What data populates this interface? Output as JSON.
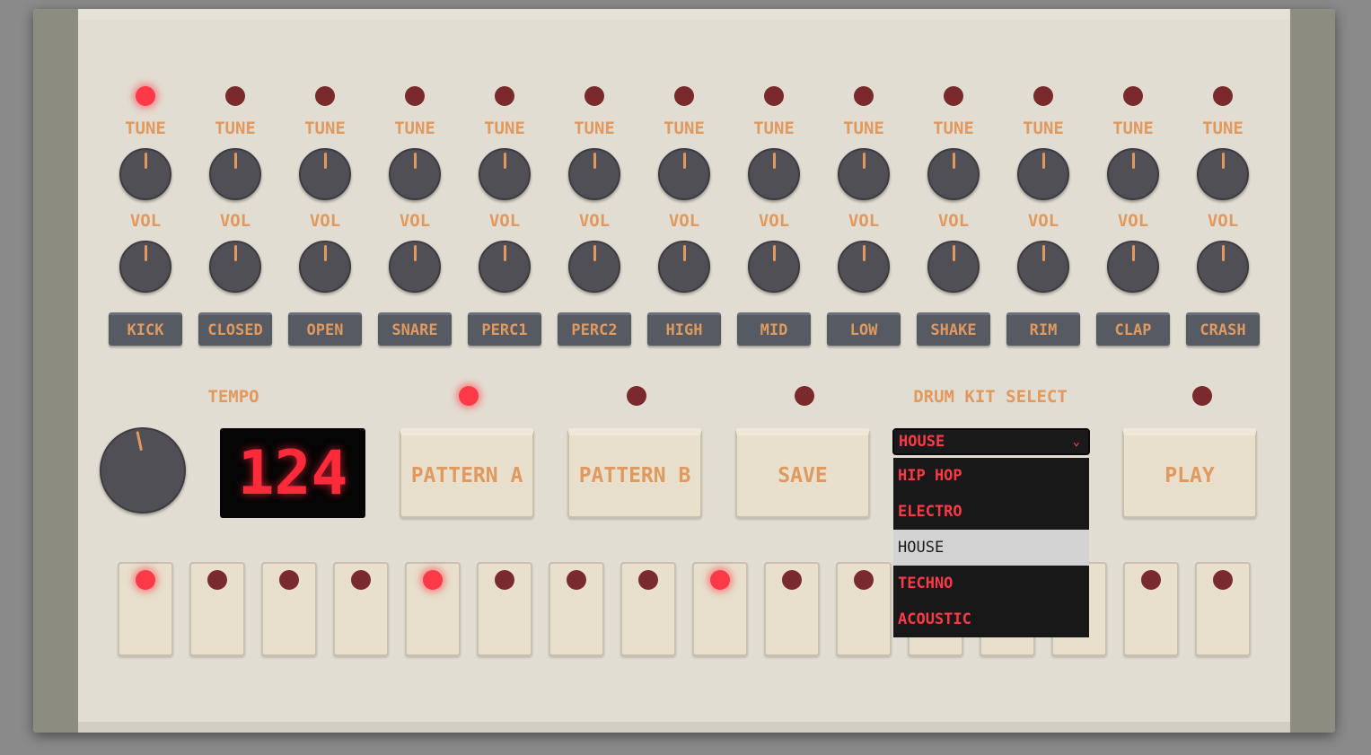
{
  "channels": [
    {
      "name": "KICK",
      "led_on": true
    },
    {
      "name": "CLOSED",
      "led_on": false
    },
    {
      "name": "OPEN",
      "led_on": false
    },
    {
      "name": "SNARE",
      "led_on": false
    },
    {
      "name": "PERC1",
      "led_on": false
    },
    {
      "name": "PERC2",
      "led_on": false
    },
    {
      "name": "HIGH",
      "led_on": false
    },
    {
      "name": "MID",
      "led_on": false
    },
    {
      "name": "LOW",
      "led_on": false
    },
    {
      "name": "SHAKE",
      "led_on": false
    },
    {
      "name": "RIM",
      "led_on": false
    },
    {
      "name": "CLAP",
      "led_on": false
    },
    {
      "name": "CRASH",
      "led_on": false
    }
  ],
  "knob_labels": {
    "tune": "TUNE",
    "vol": "VOL"
  },
  "tempo": {
    "label": "TEMPO",
    "value": "124"
  },
  "controls": {
    "pattern_a": {
      "label": "PATTERN A",
      "led_on": true
    },
    "pattern_b": {
      "label": "PATTERN B",
      "led_on": false
    },
    "save": {
      "label": "SAVE",
      "led_on": false
    },
    "play": {
      "label": "PLAY",
      "led_on": false
    }
  },
  "drum_kit": {
    "label": "DRUM KIT SELECT",
    "selected": "HOUSE",
    "options": [
      "HIP HOP",
      "ELECTRO",
      "HOUSE",
      "TECHNO",
      "ACOUSTIC"
    ]
  },
  "steps": [
    true,
    false,
    false,
    false,
    true,
    false,
    false,
    false,
    true,
    false,
    false,
    false,
    false,
    false,
    false,
    false
  ],
  "colors": {
    "accent": "#e0995e",
    "led_on": "#ff3a48",
    "led_off": "#7a2a2c",
    "panel": "#e2ddd2",
    "knob": "#4f4f55"
  }
}
